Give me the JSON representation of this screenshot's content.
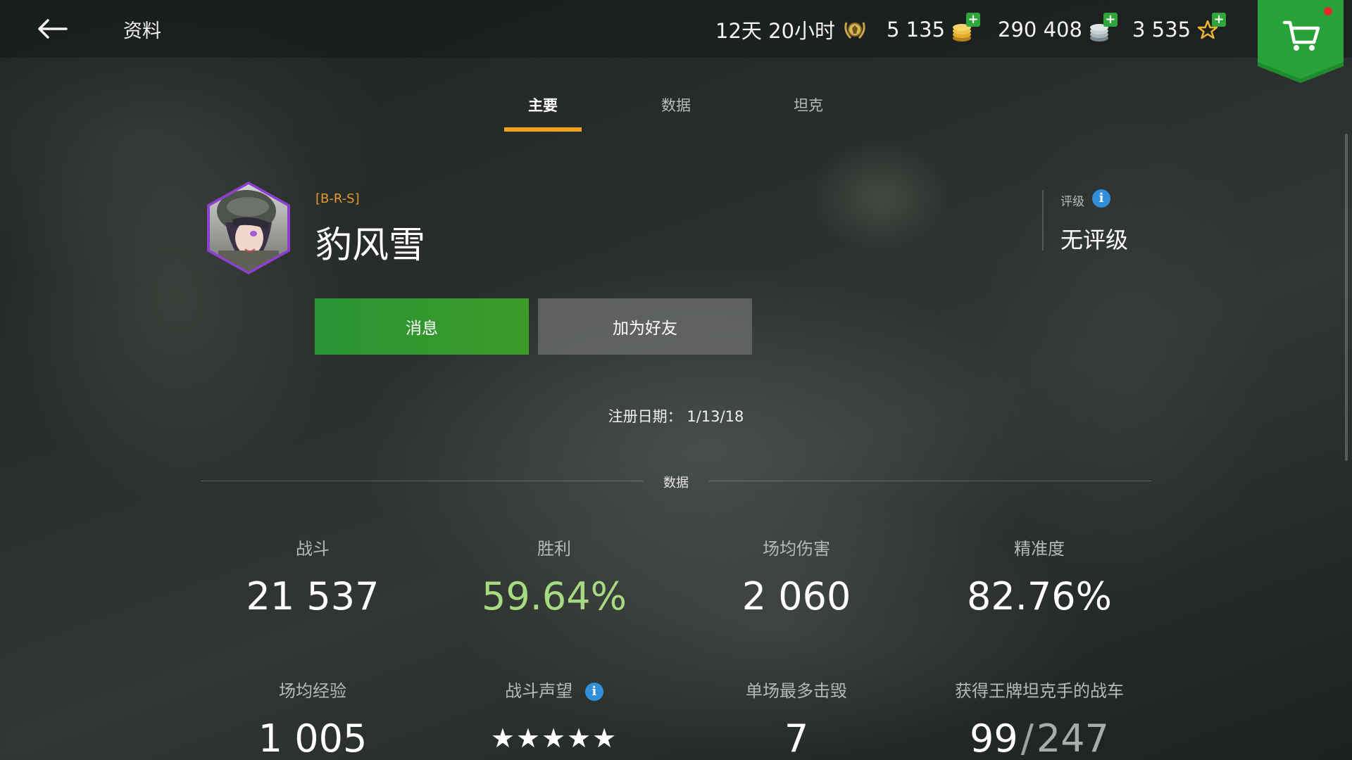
{
  "header": {
    "title": "资料",
    "timer": "12天 20小时",
    "gold": "5 135",
    "credits": "290 408",
    "free_xp": "3 535"
  },
  "tabs": [
    {
      "label": "主要",
      "active": true
    },
    {
      "label": "数据",
      "active": false
    },
    {
      "label": "坦克",
      "active": false
    }
  ],
  "profile": {
    "clan_tag": "[B-R-S]",
    "name": "豹风雪",
    "rating_label": "评级",
    "rating_value": "无评级",
    "message_button": "消息",
    "add_friend_button": "加为好友",
    "registration": "注册日期：  1/13/18"
  },
  "stats_section_title": "数据",
  "stats": {
    "battles": {
      "label": "战斗",
      "value": "21 537"
    },
    "wins": {
      "label": "胜利",
      "value": "59.64%"
    },
    "avg_damage": {
      "label": "场均伤害",
      "value": "2 060"
    },
    "accuracy": {
      "label": "精准度",
      "value": "82.76%"
    },
    "avg_xp": {
      "label": "场均经验",
      "value": "1 005"
    },
    "reputation": {
      "label": "战斗声望",
      "value": "★★★★★",
      "stars": 5
    },
    "max_kills": {
      "label": "单场最多击毁",
      "value": "7"
    },
    "mastery": {
      "label": "获得王牌坦克手的战车",
      "value": "99",
      "total": "247"
    }
  },
  "colors": {
    "accent": "#f2a31e",
    "win_green": "#a7db82",
    "message_button": "#2a9335",
    "clan_tag": "#e19a2c",
    "info_blue": "#2f8fd8"
  },
  "icons": [
    "back-arrow-icon",
    "premium-timer-icon",
    "gold-coins-icon",
    "silver-credits-icon",
    "free-xp-star-icon",
    "cart-icon",
    "info-icon"
  ]
}
